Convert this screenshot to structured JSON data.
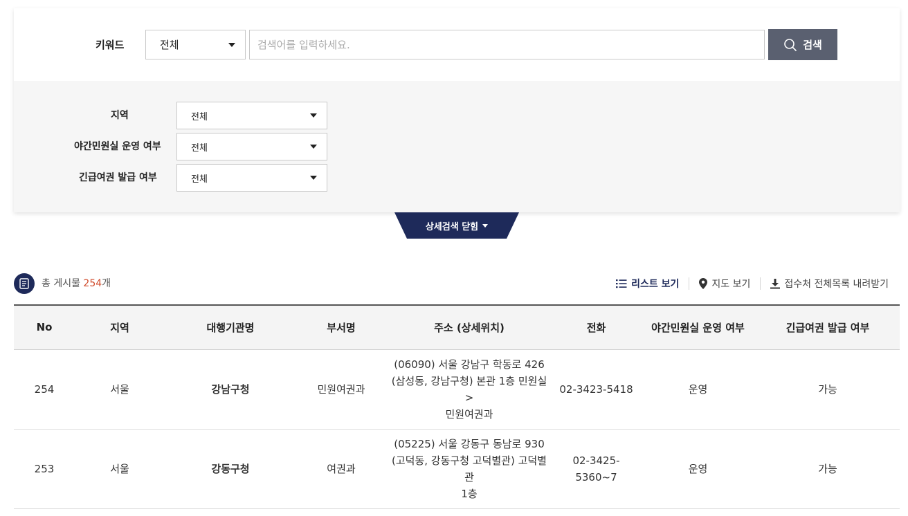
{
  "search": {
    "keyword_label": "키워드",
    "keyword_select_value": "전체",
    "placeholder": "검색어를 입력하세요.",
    "button_label": "검색"
  },
  "filters": [
    {
      "label": "지역",
      "value": "전체"
    },
    {
      "label": "야간민원실 운영 여부",
      "value": "전체"
    },
    {
      "label": "긴급여권 발급 여부",
      "value": "전체"
    }
  ],
  "toggle": {
    "label": "상세검색 닫힘"
  },
  "summary": {
    "prefix": "총 게시물 ",
    "count": "254",
    "suffix": "개"
  },
  "views": {
    "list": "리스트 보기",
    "map": "지도 보기",
    "download": "접수처 전체목록 내려받기"
  },
  "table": {
    "headers": [
      "No",
      "지역",
      "대행기관명",
      "부서명",
      "주소 (상세위치)",
      "전화",
      "야간민원실 운영 여부",
      "긴급여권 발급 여부"
    ],
    "rows": [
      {
        "no": "254",
        "region": "서울",
        "agency": "강남구청",
        "dept": "민원여권과",
        "address_line1": "(06090) 서울 강남구 학동로 426",
        "address_line2": "(삼성동, 강남구청) 본관 1층 민원실 >",
        "address_line3": "민원여권과",
        "phone_line1": "02-3423-5418",
        "phone_line2": "",
        "night": "운영",
        "urgent": "가능"
      },
      {
        "no": "253",
        "region": "서울",
        "agency": "강동구청",
        "dept": "여권과",
        "address_line1": "(05225) 서울 강동구 동남로 930",
        "address_line2": "(고덕동, 강동구청 고덕별관) 고덕별관",
        "address_line3": "1층",
        "phone_line1": "02-3425-",
        "phone_line2": "5360~7",
        "night": "운영",
        "urgent": "가능"
      }
    ]
  },
  "colors": {
    "accent": "#1e2a5a",
    "search_button": "#5a6070",
    "count": "#d04a2a"
  }
}
